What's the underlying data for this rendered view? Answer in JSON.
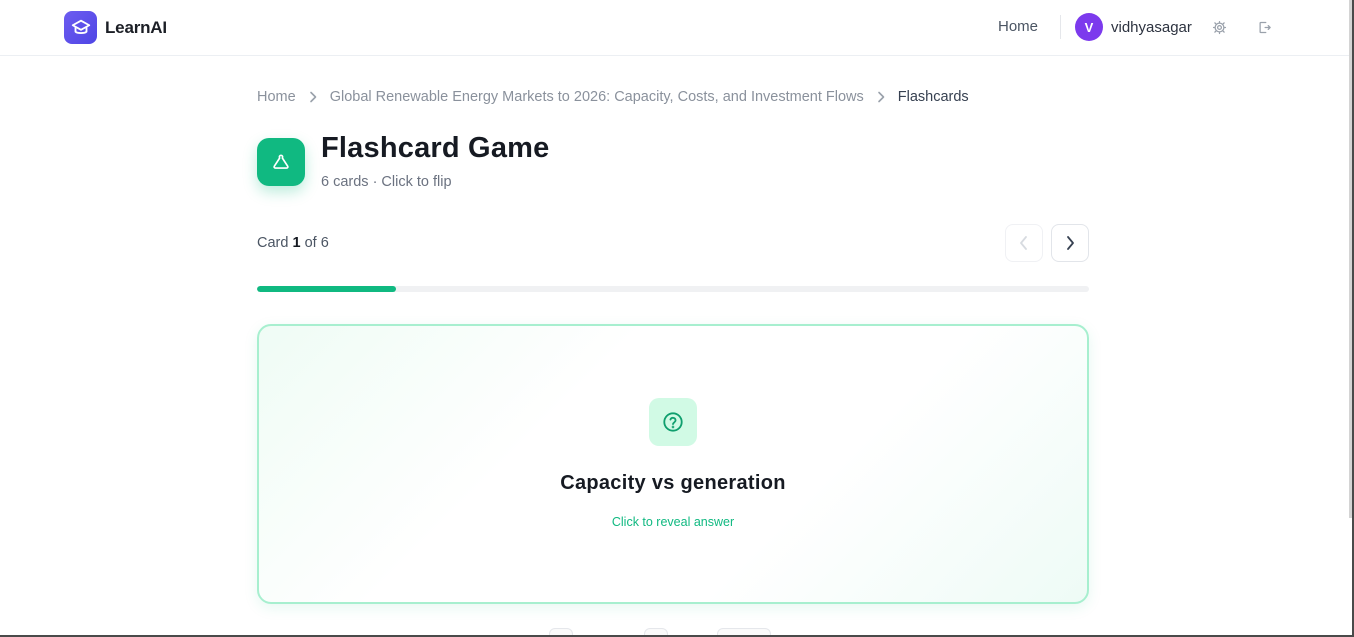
{
  "app": {
    "name": "LearnAI"
  },
  "header": {
    "home_label": "Home",
    "user": {
      "initial": "V",
      "name": "vidhyasagar"
    }
  },
  "breadcrumb": [
    "Home",
    "Global Renewable Energy Markets to 2026: Capacity, Costs, and Investment Flows",
    "Flashcards"
  ],
  "page": {
    "title": "Flashcard Game",
    "subtitle": "6 cards · Click to flip"
  },
  "counter": {
    "prefix": "Card",
    "current": "1",
    "middle": "of",
    "total": "6"
  },
  "progress": {
    "fraction": 0.1667
  },
  "card": {
    "term": "Capacity vs generation",
    "hint": "Click to reveal answer"
  },
  "colors": {
    "accent": "#10b981",
    "brand": "#5b4ee8",
    "avatar": "#7c3aed"
  }
}
